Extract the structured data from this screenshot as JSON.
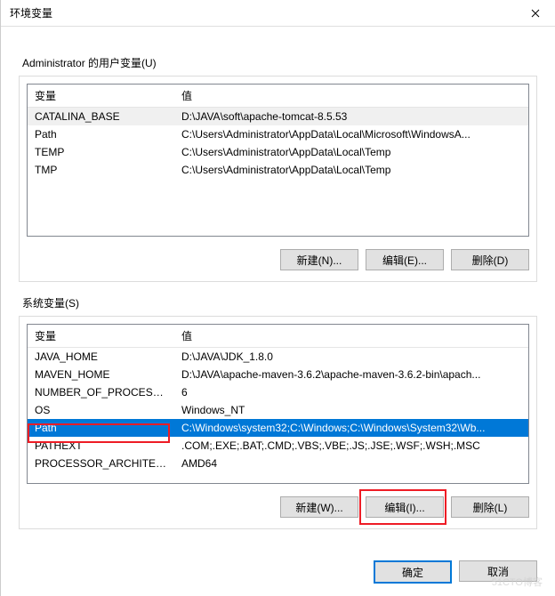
{
  "window": {
    "title": "环境变量",
    "close": "✕"
  },
  "userVars": {
    "label": "Administrator 的用户变量(U)",
    "cols": {
      "name": "变量",
      "value": "值"
    },
    "rows": [
      {
        "name": "CATALINA_BASE",
        "value": "D:\\JAVA\\soft\\apache-tomcat-8.5.53"
      },
      {
        "name": "Path",
        "value": "C:\\Users\\Administrator\\AppData\\Local\\Microsoft\\WindowsA..."
      },
      {
        "name": "TEMP",
        "value": "C:\\Users\\Administrator\\AppData\\Local\\Temp"
      },
      {
        "name": "TMP",
        "value": "C:\\Users\\Administrator\\AppData\\Local\\Temp"
      }
    ],
    "buttons": {
      "new": "新建(N)...",
      "edit": "编辑(E)...",
      "del": "删除(D)"
    }
  },
  "sysVars": {
    "label": "系统变量(S)",
    "cols": {
      "name": "变量",
      "value": "值"
    },
    "rows": [
      {
        "name": "JAVA_HOME",
        "value": "D:\\JAVA\\JDK_1.8.0"
      },
      {
        "name": "MAVEN_HOME",
        "value": "D:\\JAVA\\apache-maven-3.6.2\\apache-maven-3.6.2-bin\\apach..."
      },
      {
        "name": "NUMBER_OF_PROCESSORS",
        "value": "6"
      },
      {
        "name": "OS",
        "value": "Windows_NT"
      },
      {
        "name": "Path",
        "value": "C:\\Windows\\system32;C:\\Windows;C:\\Windows\\System32\\Wb..."
      },
      {
        "name": "PATHEXT",
        "value": ".COM;.EXE;.BAT;.CMD;.VBS;.VBE;.JS;.JSE;.WSF;.WSH;.MSC"
      },
      {
        "name": "PROCESSOR_ARCHITECT...",
        "value": "AMD64"
      }
    ],
    "selectedIndex": 4,
    "buttons": {
      "new": "新建(W)...",
      "edit": "编辑(I)...",
      "del": "删除(L)"
    }
  },
  "footer": {
    "ok": "确定",
    "cancel": "取消"
  },
  "watermark": "51CTO博客"
}
